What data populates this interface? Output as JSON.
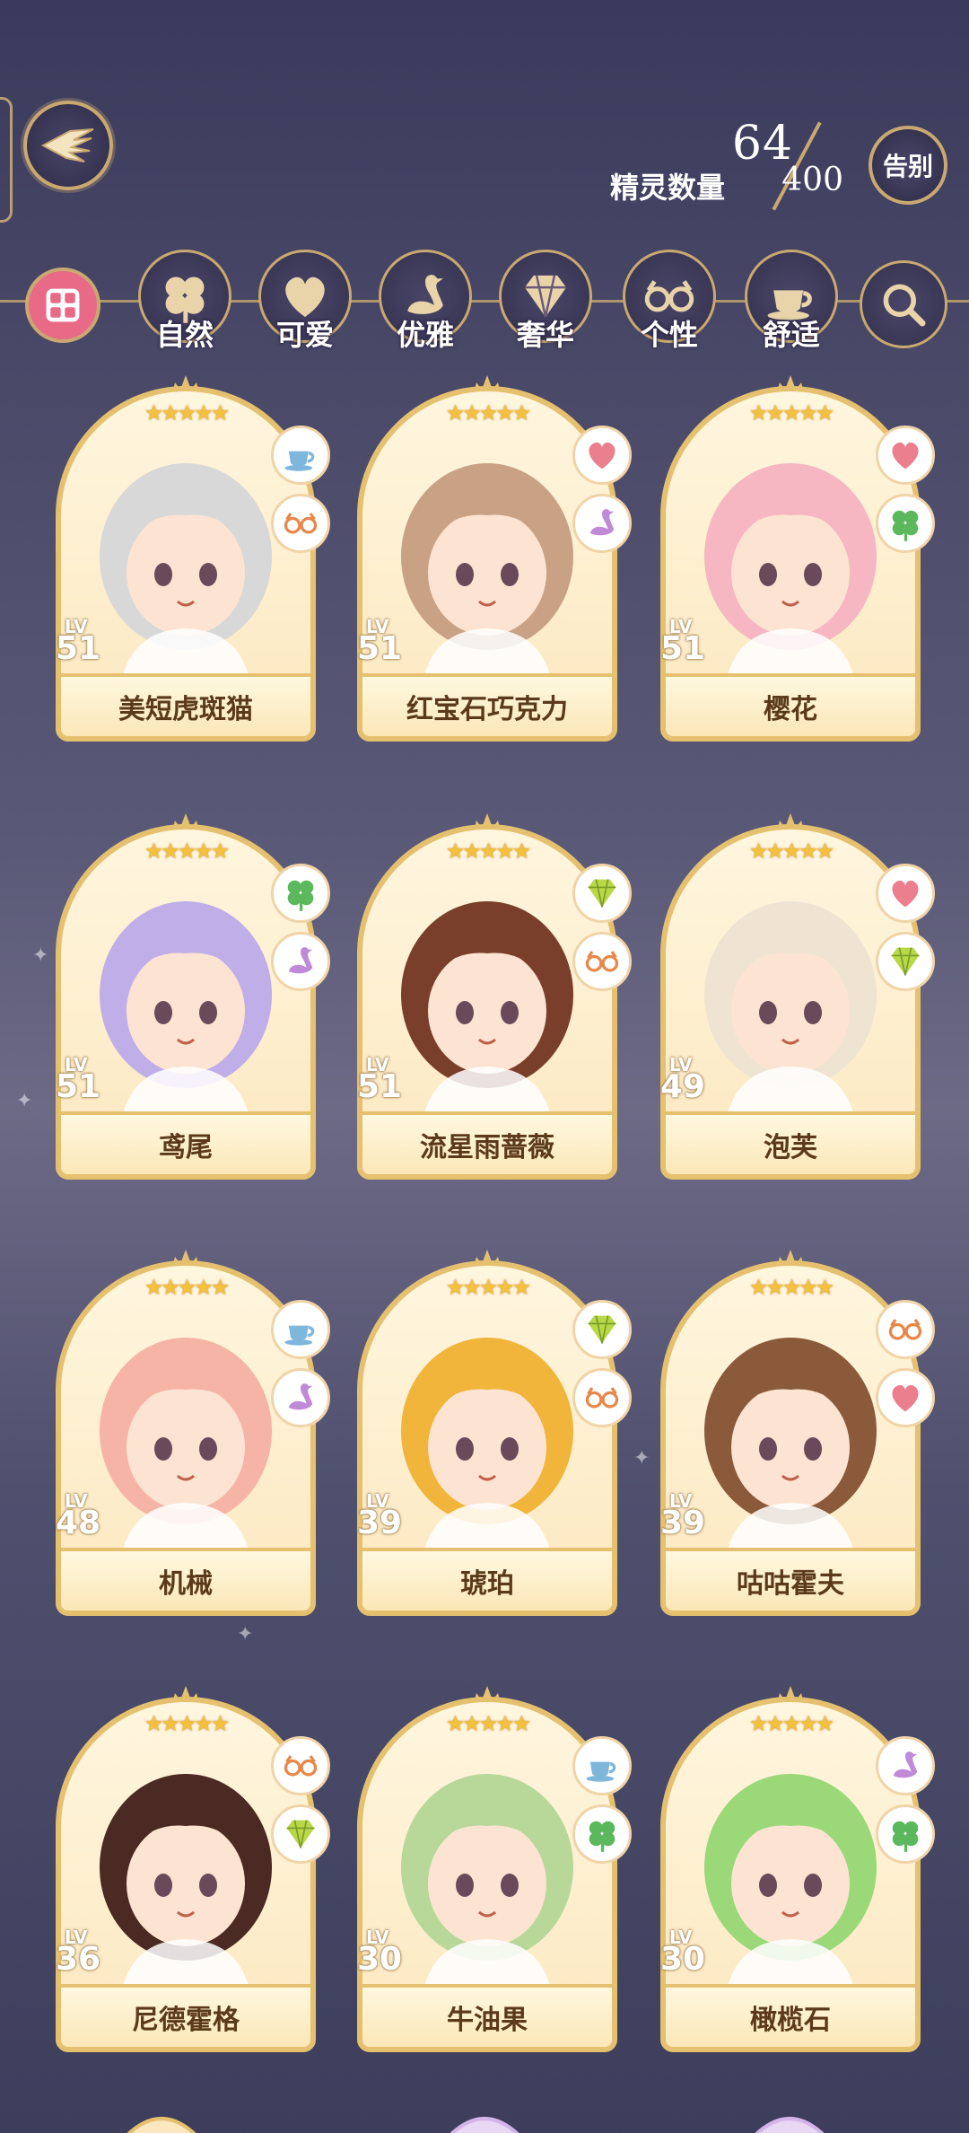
{
  "header": {
    "spirit_count_current": "64",
    "spirit_count_label": "精灵数量",
    "spirit_count_max": "400",
    "farewell_label": "告别"
  },
  "filters": [
    {
      "key": "all",
      "label": "",
      "icon": "grid-icon"
    },
    {
      "key": "nature",
      "label": "自然",
      "icon": "clover-icon"
    },
    {
      "key": "cute",
      "label": "可爱",
      "icon": "heart-icon"
    },
    {
      "key": "elegant",
      "label": "优雅",
      "icon": "swan-icon"
    },
    {
      "key": "luxury",
      "label": "奢华",
      "icon": "diamond-icon"
    },
    {
      "key": "personality",
      "label": "个性",
      "icon": "glasses-icon"
    },
    {
      "key": "comfort",
      "label": "舒适",
      "icon": "teacup-icon"
    },
    {
      "key": "search",
      "label": "",
      "icon": "search-icon"
    }
  ],
  "colors": {
    "accent_gold": "#e5c16f",
    "card_bg": "#fce8c0",
    "filter_active": "#e96a86"
  },
  "cards": [
    {
      "name": "美短虎斑猫",
      "level": "51",
      "stars": "★★★★★",
      "traits": [
        "teacup",
        "glasses"
      ],
      "hair": "#d8d8d8"
    },
    {
      "name": "红宝石巧克力",
      "level": "51",
      "stars": "★★★★★",
      "traits": [
        "heart",
        "swan"
      ],
      "hair": "#c9a184"
    },
    {
      "name": "樱花",
      "level": "51",
      "stars": "★★★★★",
      "traits": [
        "heart",
        "clover"
      ],
      "hair": "#f6b6c2"
    },
    {
      "name": "鸢尾",
      "level": "51",
      "stars": "★★★★★",
      "traits": [
        "clover",
        "swan"
      ],
      "hair": "#c0aee8"
    },
    {
      "name": "流星雨蔷薇",
      "level": "51",
      "stars": "★★★★★",
      "traits": [
        "diamond",
        "glasses"
      ],
      "hair": "#7a3f2a"
    },
    {
      "name": "泡芙",
      "level": "49",
      "stars": "★★★★★",
      "traits": [
        "heart",
        "diamond"
      ],
      "hair": "#efe4d2"
    },
    {
      "name": "机械",
      "level": "48",
      "stars": "★★★★★",
      "traits": [
        "teacup",
        "swan"
      ],
      "hair": "#f6b4a6"
    },
    {
      "name": "琥珀",
      "level": "39",
      "stars": "★★★★★",
      "traits": [
        "diamond",
        "glasses"
      ],
      "hair": "#f0b53a"
    },
    {
      "name": "咕咕霍夫",
      "level": "39",
      "stars": "★★★★★",
      "traits": [
        "glasses",
        "heart"
      ],
      "hair": "#8b5a3a"
    },
    {
      "name": "尼德霍格",
      "level": "36",
      "stars": "★★★★★",
      "traits": [
        "glasses",
        "diamond"
      ],
      "hair": "#4a2a22"
    },
    {
      "name": "牛油果",
      "level": "30",
      "stars": "★★★★★",
      "traits": [
        "teacup",
        "clover"
      ],
      "hair": "#b8d89a"
    },
    {
      "name": "橄榄石",
      "level": "30",
      "stars": "★★★★★",
      "traits": [
        "swan",
        "clover"
      ],
      "hair": "#9ad878"
    }
  ]
}
